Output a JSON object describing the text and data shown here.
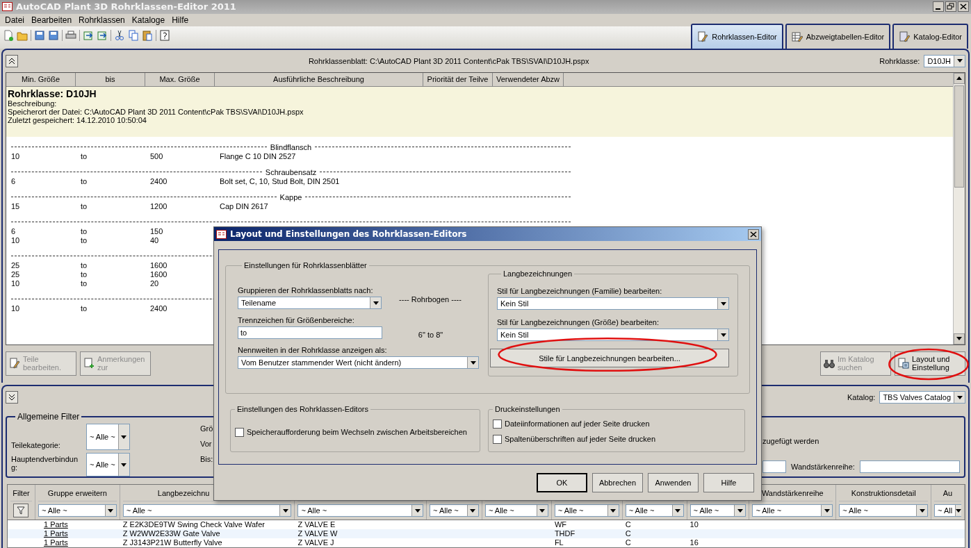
{
  "window": {
    "title": "AutoCAD Plant 3D Rohrklassen-Editor 2011"
  },
  "menu": [
    "Datei",
    "Bearbeiten",
    "Rohrklassen",
    "Kataloge",
    "Hilfe"
  ],
  "editor_tabs": [
    {
      "label": "Rohrklassen-Editor",
      "selected": true
    },
    {
      "label": "Abzweigtabellen-Editor",
      "selected": false
    },
    {
      "label": "Katalog-Editor",
      "selected": false
    }
  ],
  "sheet": {
    "path": "Rohrklassenblatt: C:\\AutoCAD Plant 3D 2011 Content\\cPak TBS\\SVAI\\D10JH.pspx",
    "class_label": "Rohrklasse:",
    "class_value": "D10JH",
    "columns": [
      "Min. Größe",
      "bis",
      "Max. Größe",
      "Ausführliche Beschreibung",
      "Priorität der Teilve",
      "Verwendeter Abzw"
    ],
    "info": {
      "title": "Rohrklasse: D10JH",
      "lines": [
        "Beschreibung:",
        "Speicherort der Datei: C:\\AutoCAD Plant 3D 2011 Content\\cPak TBS\\SVAI\\D10JH.pspx",
        "Zuletzt gespeichert: 14.12.2010 10:50:04"
      ]
    },
    "groups": [
      {
        "heading": "Blindflansch",
        "rows": [
          [
            "10",
            "to",
            "500",
            "Flange C 10 DIN 2527"
          ]
        ]
      },
      {
        "heading": "Schraubensatz",
        "rows": [
          [
            "6",
            "to",
            "2400",
            "Bolt set, C, 10, Stud Bolt, DIN 2501"
          ]
        ]
      },
      {
        "heading": "Kappe",
        "rows": [
          [
            "15",
            "to",
            "1200",
            "Cap DIN 2617"
          ]
        ]
      },
      {
        "rows": [
          [
            "6",
            "to",
            "150"
          ],
          [
            "10",
            "to",
            "40"
          ]
        ]
      },
      {
        "rows": [
          [
            "25",
            "to",
            "1600"
          ],
          [
            "25",
            "to",
            "1600"
          ],
          [
            "10",
            "to",
            "20"
          ]
        ]
      },
      {
        "rows": [
          [
            "10",
            "to",
            "2400"
          ]
        ]
      }
    ]
  },
  "sheet_buttons_left": [
    {
      "label": "Teile bearbeiten.",
      "disabled": true
    },
    {
      "label": "Anmerkungen zur",
      "disabled": true
    }
  ],
  "sheet_buttons_right": [
    {
      "label": "Im Katalog suchen",
      "disabled": true,
      "highlighted": false
    },
    {
      "label": "Layout und Einstellung",
      "disabled": false,
      "highlighted": true
    }
  ],
  "catalog": {
    "label": "Katalog:",
    "value": "TBS Valves Catalog"
  },
  "filters": {
    "title": "Allgemeine Filter",
    "fields": [
      {
        "label": "Teilekategorie:",
        "value": "~ Alle ~"
      },
      {
        "label": "Hauptendverbindung:",
        "value": "~ Alle ~"
      }
    ],
    "covered_labels": [
      "Grö",
      "Vor",
      "Bis:"
    ],
    "note": "zugefügt werden",
    "wall_label": "Wandstärkenreihe:"
  },
  "grid": {
    "columns": [
      {
        "header": "Filter",
        "kind": "filter"
      },
      {
        "header": "Gruppe erweitern",
        "filter": "~ Alle ~",
        "kind": "text"
      },
      {
        "header": "Langbezeichnu",
        "filter": "~ Alle ~",
        "kind": "text"
      },
      {
        "filter": "~ Alle ~",
        "kind": "text"
      },
      {
        "filter": "~ Alle ~",
        "kind": "text"
      },
      {
        "filter": "~ Alle ~",
        "kind": "text"
      },
      {
        "filter": "~ Alle ~",
        "kind": "text"
      },
      {
        "filter": "~ Alle ~",
        "kind": "text"
      },
      {
        "filter": "~ Alle ~",
        "kind": "text"
      },
      {
        "header": "Wandstärkenreihe",
        "filter": "~ Alle ~",
        "kind": "text"
      },
      {
        "header": "Konstruktionsdetail",
        "filter": "~ Alle ~",
        "kind": "text"
      },
      {
        "header": "Au",
        "filter": "~ All",
        "kind": "text"
      }
    ],
    "rows": [
      {
        "gruppe": "1 Parts",
        "langbezeichnung": "Z E2K3DE9TW Swing Check Valve Wafer",
        "column_4": "Z VALVE E",
        "column_7": "WF",
        "column_8": "C",
        "column_9": "10"
      },
      {
        "gruppe": "1 Parts",
        "langbezeichnung": "Z W2WW2E33W Gate Valve",
        "column_4": "Z VALVE W",
        "column_7": "THDF",
        "column_8": "C"
      },
      {
        "gruppe": "1 Parts",
        "langbezeichnung": "Z J3143P21W Butterfly Valve",
        "column_4": "Z VALVE J",
        "column_7": "FL",
        "column_8": "C",
        "column_9": "16"
      }
    ]
  },
  "dialog": {
    "title": "Layout und Einstellungen des Rohrklassen-Editors",
    "sheet_settings": {
      "title": "Einstellungen für Rohrklassenblätter",
      "group_by": {
        "label": "Gruppieren der Rohrklassenblatts nach:",
        "value": "Teilename"
      },
      "separator": {
        "label": "Trennzeichen für Größenbereiche:",
        "value": "to"
      },
      "sizes": {
        "label": "Nennweiten in der Rohrklasse anzeigen als:",
        "value": "Vom Benutzer stammender Wert (nicht ändern)"
      },
      "preview": [
        "---- Rohrbogen ----",
        "6\" to 8\""
      ],
      "long_names": {
        "title": "Langbezeichnungen",
        "family": {
          "label": "Stil für Langbezeichnungen (Familie) bearbeiten:",
          "value": "Kein Stil"
        },
        "size": {
          "label": "Stil für Langbezeichnungen (Größe) bearbeiten:",
          "value": "Kein Stil"
        },
        "button": {
          "label": "Stile für Langbezeichnungen bearbeiten...",
          "highlighted": true
        }
      }
    },
    "editor_settings": {
      "title": "Einstellungen des Rohrklassen-Editors",
      "options": [
        {
          "label": "Speicheraufforderung beim Wechseln zwischen Arbeitsbereichen",
          "checked": false
        }
      ]
    },
    "print_settings": {
      "title": "Druckeinstellungen",
      "options": [
        {
          "label": "Dateiinformationen auf jeder Seite drucken",
          "checked": false
        },
        {
          "label": "Spaltenüberschriften auf jeder Seite drucken",
          "checked": false
        }
      ]
    },
    "buttons": [
      {
        "label": "OK",
        "default": true
      },
      {
        "label": "Abbrechen",
        "default": false
      },
      {
        "label": "Anwenden",
        "default": false
      },
      {
        "label": "Hilfe",
        "default": false
      }
    ]
  }
}
